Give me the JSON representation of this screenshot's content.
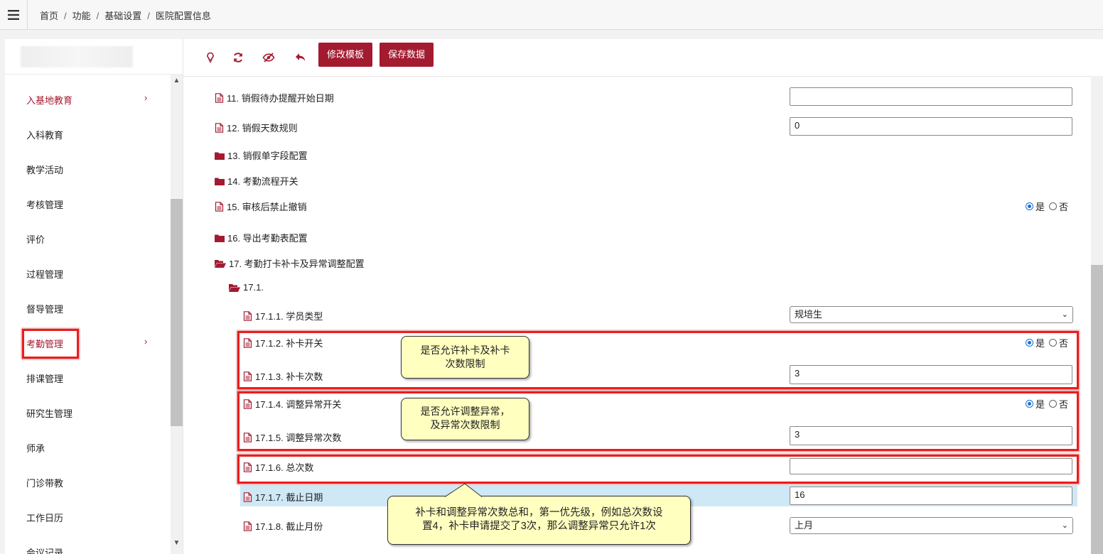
{
  "breadcrumb": {
    "home": "首页",
    "func": "功能",
    "base": "基础设置",
    "current": "医院配置信息",
    "sep": "/"
  },
  "sidebar": {
    "items": [
      {
        "label": "入基地教育",
        "active": true,
        "chevron": "›"
      },
      {
        "label": "入科教育"
      },
      {
        "label": "教学活动"
      },
      {
        "label": "考核管理"
      },
      {
        "label": "评价"
      },
      {
        "label": "过程管理"
      },
      {
        "label": "督导管理"
      },
      {
        "label": "考勤管理",
        "chevron": "›"
      },
      {
        "label": "排课管理"
      },
      {
        "label": "研究生管理"
      },
      {
        "label": "师承"
      },
      {
        "label": "门诊带教"
      },
      {
        "label": "工作日历"
      },
      {
        "label": "会议记录"
      }
    ]
  },
  "toolbar": {
    "edit_template": "修改模板",
    "save_data": "保存数据",
    "icons": [
      "lightbulb-icon",
      "refresh-icon",
      "hide-eye-icon",
      "undo-icon"
    ]
  },
  "config": {
    "r11": {
      "label": "11. 销假待办提醒开始日期",
      "value": ""
    },
    "r12": {
      "label": "12. 销假天数规则",
      "value": "0"
    },
    "r13": {
      "label": "13. 销假单字段配置"
    },
    "r14": {
      "label": "14. 考勤流程开关"
    },
    "r15": {
      "label": "15. 审核后禁止撤销",
      "yes": "是",
      "no": "否"
    },
    "r16": {
      "label": "16. 导出考勤表配置"
    },
    "r17": {
      "label": "17. 考勤打卡补卡及异常调整配置"
    },
    "r17_1": {
      "label": "17.1."
    },
    "r17_1_1": {
      "label": "17.1.1. 学员类型",
      "value": "规培生"
    },
    "r17_1_2": {
      "label": "17.1.2. 补卡开关",
      "yes": "是",
      "no": "否"
    },
    "r17_1_3": {
      "label": "17.1.3. 补卡次数",
      "value": "3"
    },
    "r17_1_4": {
      "label": "17.1.4. 调整异常开关",
      "yes": "是",
      "no": "否"
    },
    "r17_1_5": {
      "label": "17.1.5. 调整异常次数",
      "value": "3"
    },
    "r17_1_6": {
      "label": "17.1.6. 总次数",
      "value": ""
    },
    "r17_1_7": {
      "label": "17.1.7. 截止日期",
      "value": "16"
    },
    "r17_1_8": {
      "label": "17.1.8. 截止月份",
      "value": "上月"
    }
  },
  "annotations": {
    "a1": {
      "line1": "是否允许补卡及补卡",
      "line2": "次数限制"
    },
    "a2": {
      "line1": "是否允许调整异常，",
      "line2": "及异常次数限制"
    },
    "a3": {
      "line1": "补卡和调整异常次数总和，第一优先级，例如总次数设",
      "line2": "置4，补卡申请提交了3次，那么调整异常只允许1次"
    }
  },
  "colors": {
    "brand": "#a31b30",
    "annotation_border": "#ee1c1c",
    "callout_bg": "#ffffc0",
    "row_highlight": "#cfe8f5",
    "radio_on": "#1a6fd1"
  }
}
